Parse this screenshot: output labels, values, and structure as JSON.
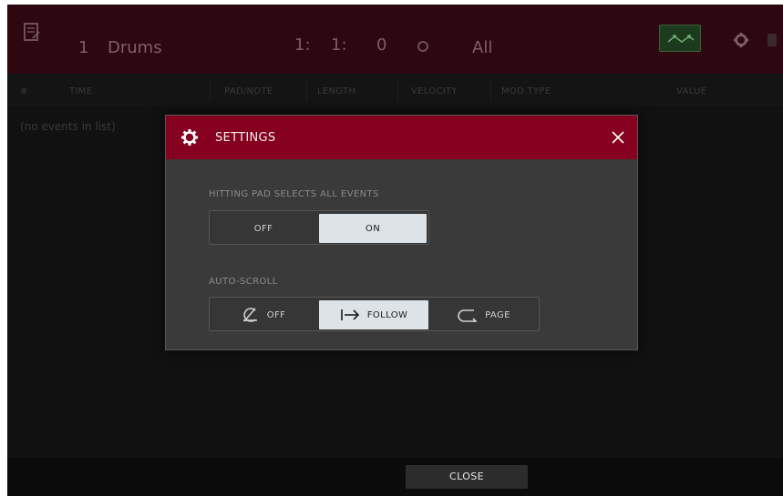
{
  "header": {
    "track_number": "1",
    "track_name": "Drums",
    "position_bar": "1:",
    "position_beat": "1:",
    "position_tick": "0",
    "filter_value": "All"
  },
  "columns": [
    "#",
    "TIME",
    "PAD/NOTE",
    "LENGTH",
    "VELOCITY",
    "MOD TYPE",
    "VALUE"
  ],
  "list": {
    "empty_text": "(no events in list)"
  },
  "dialog": {
    "title": "SETTINGS",
    "hitting_pad": {
      "label": "HITTING PAD SELECTS ALL EVENTS",
      "off_label": "OFF",
      "on_label": "ON",
      "selected": "ON"
    },
    "auto_scroll": {
      "label": "AUTO-SCROLL",
      "off_label": "OFF",
      "follow_label": "FOLLOW",
      "page_label": "PAGE",
      "selected": "FOLLOW"
    }
  },
  "bottom": {
    "close_label": "CLOSE"
  },
  "colors": {
    "accent_red": "#86001f",
    "header_dim_red": "#2e0810",
    "active_segment": "#dde3e6"
  },
  "icons": {
    "edit": "list-edit-icon",
    "automation": "automation-icon",
    "settings": "gear-icon",
    "battery": "battery-icon",
    "record": "record-icon",
    "close": "close-icon",
    "scroll_off": "scroll-off-icon",
    "scroll_follow": "arrow-right-bar-icon",
    "scroll_page": "page-return-icon"
  }
}
